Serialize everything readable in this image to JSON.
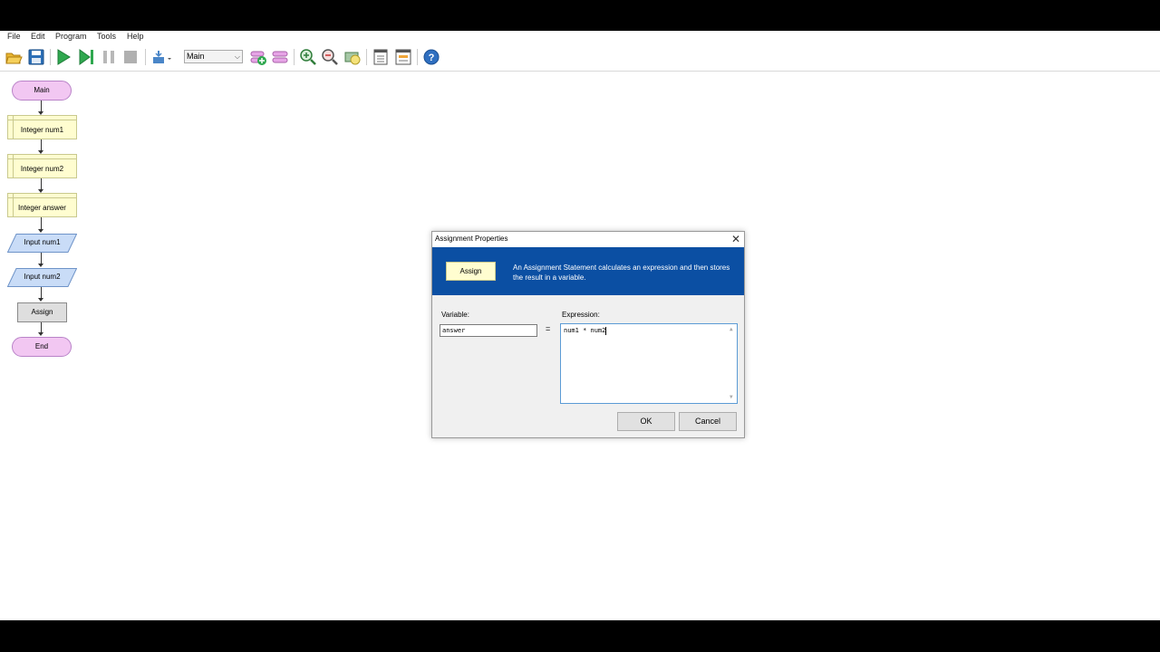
{
  "menu": {
    "items": [
      "File",
      "Edit",
      "Program",
      "Tools",
      "Help"
    ]
  },
  "toolbar": {
    "subchart_select": "Main",
    "icons": [
      "open-folder-icon",
      "save-icon",
      "run-icon",
      "step-icon",
      "pause-icon",
      "stop-icon",
      "layout-icon",
      "add-function-icon",
      "remove-function-icon",
      "zoom-in-icon",
      "zoom-out-icon",
      "zoom-fit-icon",
      "console-window-icon",
      "variables-window-icon",
      "help-icon"
    ]
  },
  "flowchart": {
    "start": "Main",
    "decl1": "Integer num1",
    "decl2": "Integer num2",
    "decl3": "Integer answer",
    "input1": "Input num1",
    "input2": "Input num2",
    "assign": "Assign",
    "end": "End"
  },
  "dialog": {
    "title": "Assignment Properties",
    "banner_shape_label": "Assign",
    "banner_text": "An Assignment Statement calculates an expression and then stores the result in a variable.",
    "variable_label": "Variable:",
    "variable_value": "answer",
    "equals": "=",
    "expression_label": "Expression:",
    "expression_value": "num1 * num2",
    "ok_label": "OK",
    "cancel_label": "Cancel",
    "close_glyph": "✕"
  },
  "colors": {
    "banner_blue": "#0b4fa3",
    "terminal_pink": "#f2c7f2",
    "declare_yellow": "#fffdd0",
    "input_blue": "#c9dcf7",
    "process_gray": "#dedede"
  }
}
